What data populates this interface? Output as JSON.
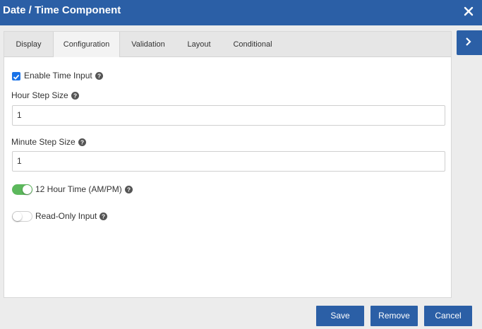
{
  "dialog": {
    "title": "Date / Time Component",
    "close_icon": "close-icon",
    "accent": "#2b5fa6"
  },
  "tabs": [
    {
      "label": "Display"
    },
    {
      "label": "Configuration"
    },
    {
      "label": "Validation"
    },
    {
      "label": "Layout"
    },
    {
      "label": "Conditional"
    }
  ],
  "active_tab": "Configuration",
  "fields": {
    "enable_time": {
      "label": "Enable Time Input",
      "checked": true
    },
    "hour_step": {
      "label": "Hour Step Size",
      "value": "1"
    },
    "minute_step": {
      "label": "Minute Step Size",
      "value": "1"
    },
    "twelve_hour": {
      "label": "12 Hour Time (AM/PM)",
      "on": true,
      "color": "#5cb85c"
    },
    "read_only": {
      "label": "Read-Only Input",
      "on": false
    }
  },
  "footer": {
    "save": "Save",
    "remove": "Remove",
    "cancel": "Cancel"
  }
}
